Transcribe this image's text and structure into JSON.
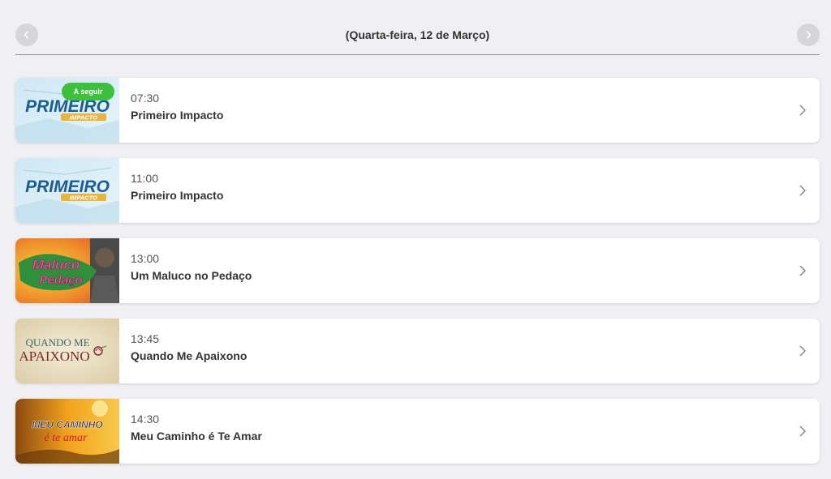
{
  "header": {
    "date": "(Quarta-feira, 12 de Março)",
    "prev_icon": "chevron-left-icon",
    "next_icon": "chevron-right-icon"
  },
  "programs": [
    {
      "time": "07:30",
      "title": "Primeiro Impacto",
      "badge": "A seguir",
      "thumb_logo": "PRIMEIRO",
      "thumb_sub": "IMPACTO"
    },
    {
      "time": "11:00",
      "title": "Primeiro Impacto",
      "thumb_logo": "PRIMEIRO",
      "thumb_sub": "IMPACTO"
    },
    {
      "time": "13:00",
      "title": "Um Maluco no Pedaço",
      "thumb_logo": "Maluco",
      "thumb_sub": "Pedaço"
    },
    {
      "time": "13:45",
      "title": "Quando Me Apaixono",
      "thumb_logo": "QUANDO ME",
      "thumb_sub": "APAIXONO"
    },
    {
      "time": "14:30",
      "title": "Meu Caminho é Te Amar",
      "thumb_logo": "MEU CAMINHO",
      "thumb_sub": "é te amar"
    }
  ],
  "colors": {
    "badge": "#3ec03e",
    "background": "#f0f0f4",
    "card": "#ffffff"
  }
}
